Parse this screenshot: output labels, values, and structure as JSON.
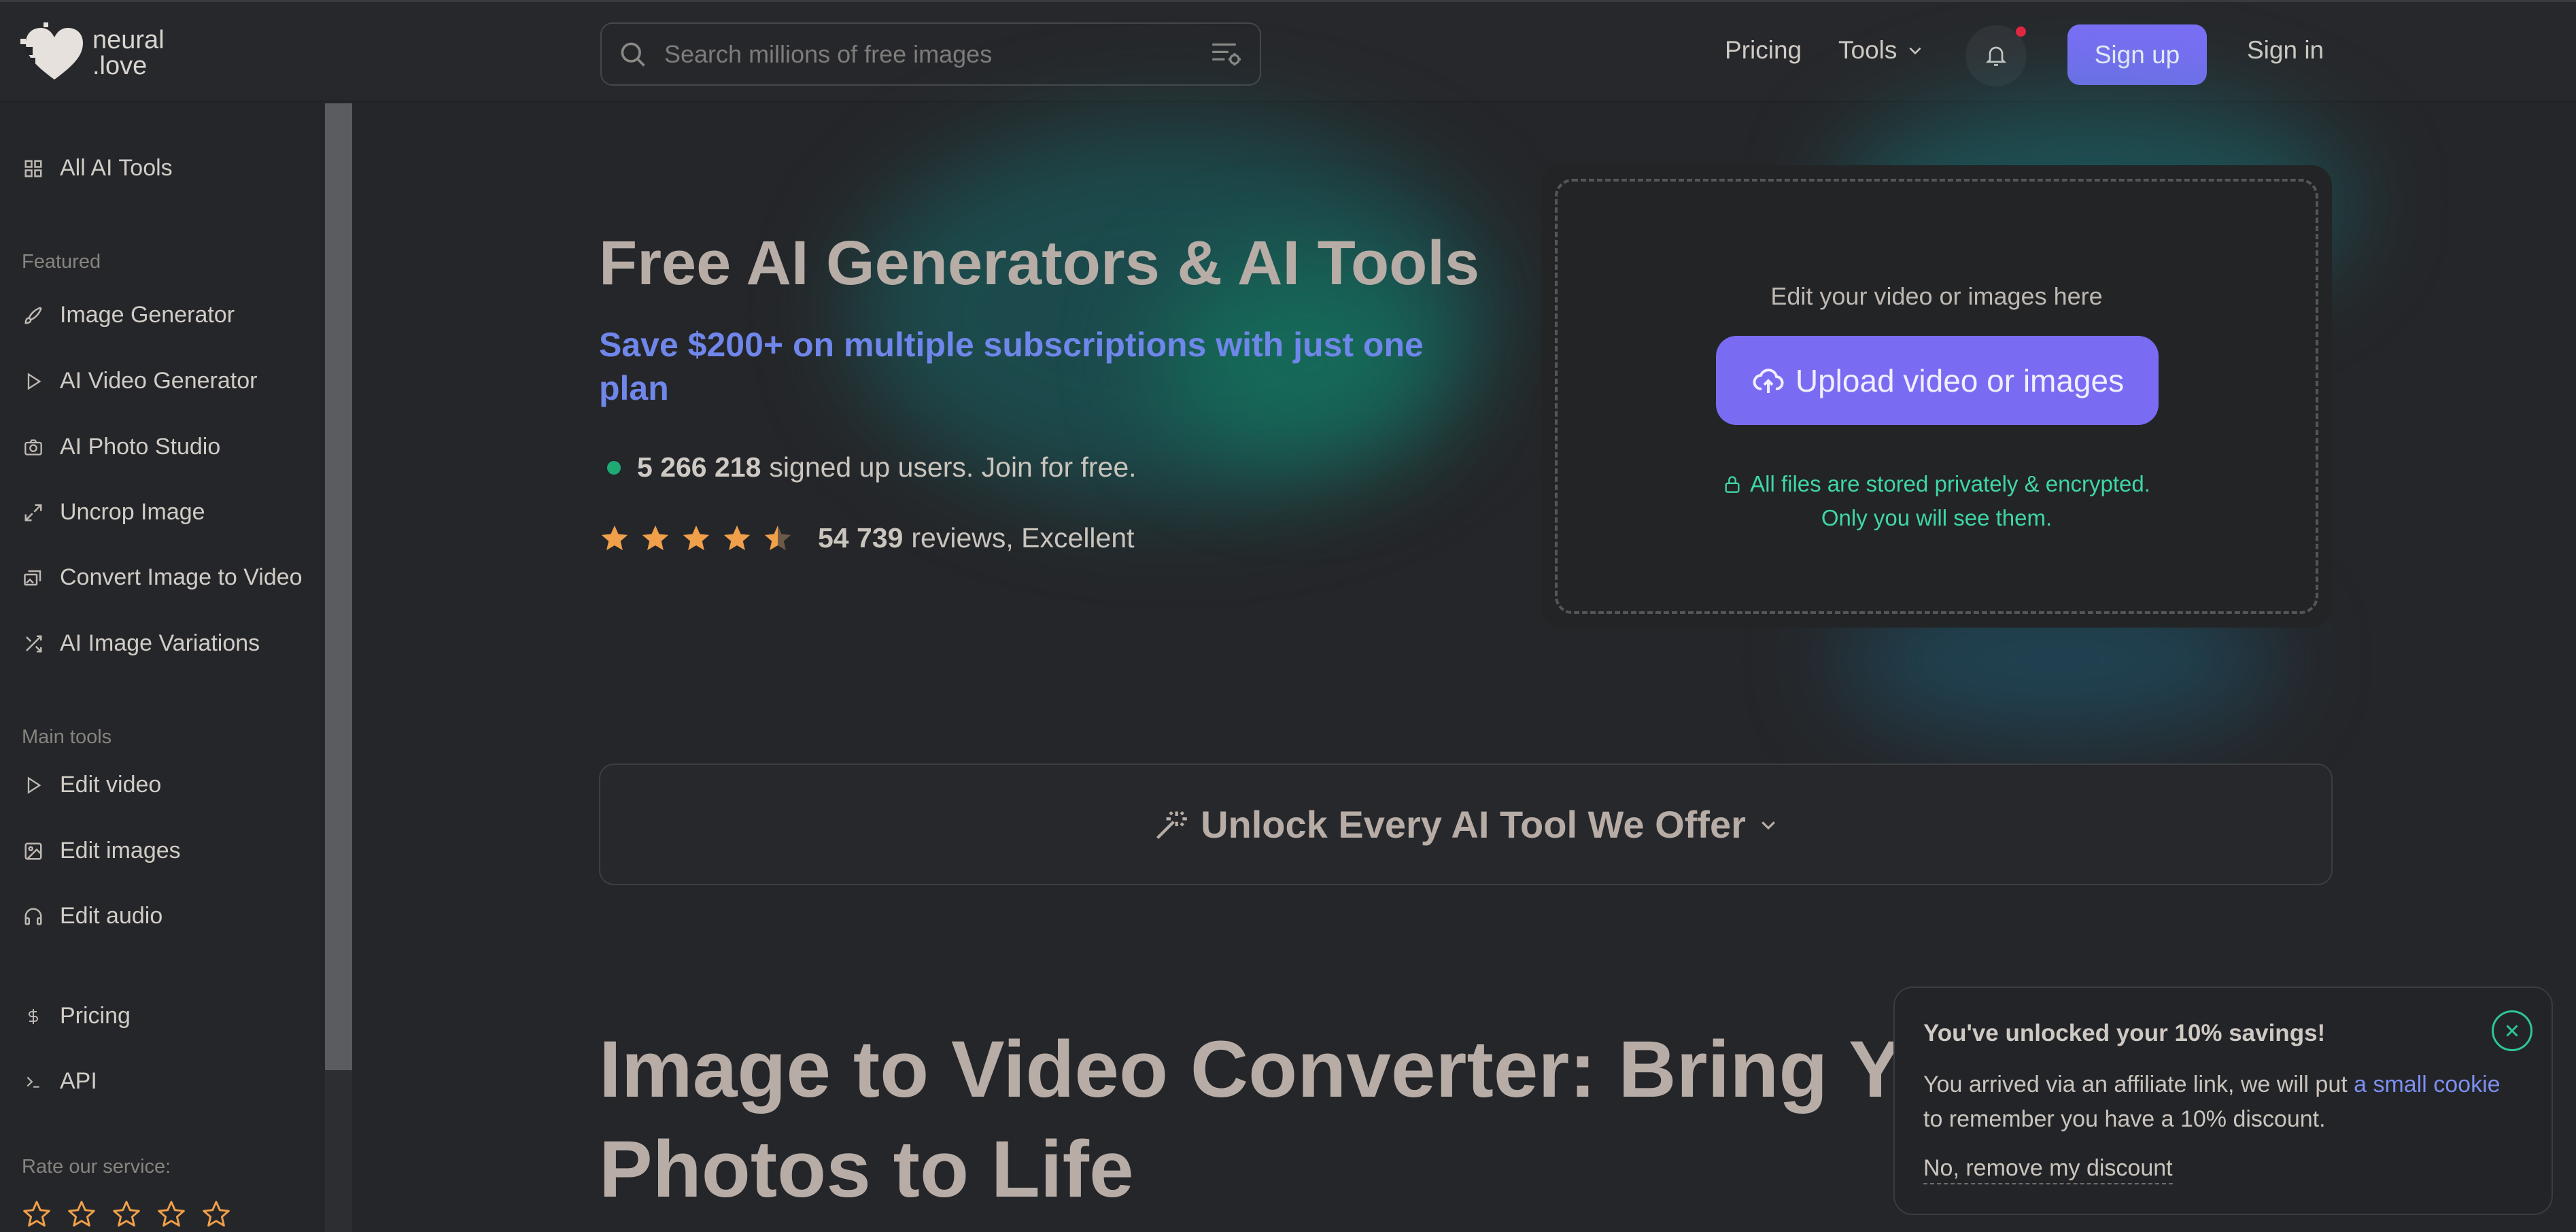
{
  "header": {
    "logo_line1": "neural",
    "logo_line2": ".love",
    "search_placeholder": "Search millions of free images",
    "nav": {
      "pricing": "Pricing",
      "tools": "Tools"
    },
    "sign_up": "Sign up",
    "sign_in": "Sign in"
  },
  "sidebar": {
    "all_tools": "All AI Tools",
    "featured_title": "Featured",
    "featured": [
      {
        "label": "Image Generator",
        "icon": "brush-icon"
      },
      {
        "label": "AI Video Generator",
        "icon": "play-icon"
      },
      {
        "label": "AI Photo Studio",
        "icon": "camera-icon"
      },
      {
        "label": "Uncrop Image",
        "icon": "expand-icon"
      },
      {
        "label": "Convert Image to Video",
        "icon": "image-video-icon"
      },
      {
        "label": "AI Image Variations",
        "icon": "shuffle-icon"
      }
    ],
    "main_tools_title": "Main tools",
    "main_tools": [
      {
        "label": "Edit video",
        "icon": "play-icon"
      },
      {
        "label": "Edit images",
        "icon": "image-icon"
      },
      {
        "label": "Edit audio",
        "icon": "headphones-icon"
      }
    ],
    "pricing": "Pricing",
    "api": "API",
    "rate_title": "Rate our service:",
    "rate_stars": 5
  },
  "hero": {
    "title": "Free AI Generators & AI Tools",
    "subtitle": "Save $200+ on multiple subscriptions with just one plan",
    "users_count": "5 266 218",
    "users_text": "signed up users. Join for free.",
    "rating": 4.5,
    "reviews_count": "54 739",
    "reviews_text": "reviews, Excellent"
  },
  "upload": {
    "hint": "Edit your video or images here",
    "button": "Upload video or images",
    "secure_line1": "All files are stored privately & encrypted.",
    "secure_line2": "Only you will see them."
  },
  "unlock": {
    "label": "Unlock Every AI Tool We Offer"
  },
  "section": {
    "title": "Image to Video Converter: Bring Your Photos to Life"
  },
  "toast": {
    "title": "You've unlocked your 10% savings!",
    "body_before": "You arrived via an affiliate link, we will put ",
    "body_link": "a small cookie",
    "body_after": " to remember you have a 10% discount.",
    "remove": "No, remove my discount"
  },
  "colors": {
    "accent": "#7b6ef6",
    "subtitle_blue": "#6f86ea",
    "secure_green": "#3fd6a8",
    "star_orange": "#f0a04b",
    "notification_red": "#e5253f"
  }
}
